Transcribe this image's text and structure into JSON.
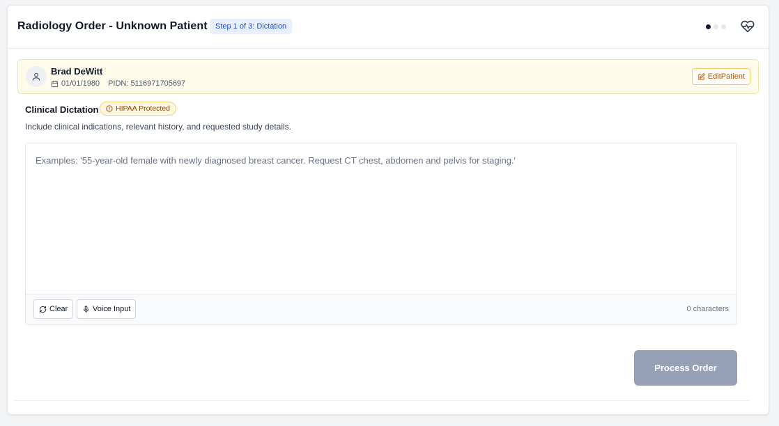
{
  "header": {
    "title": "Radiology Order - Unknown Patient",
    "step_badge": "Step 1 of 3: Dictation",
    "step_indicator": {
      "total": 3,
      "current": 1
    },
    "heart_icon": "heart-pulse-icon"
  },
  "patient": {
    "name": "Brad DeWitt",
    "dob": "01/01/1980",
    "pidn": "PIDN: 5116971705697",
    "edit_label": "EditPatient"
  },
  "dictation": {
    "label": "Clinical Dictation",
    "hipaa_badge": "HIPAA Protected",
    "description": "Include clinical indications, relevant history, and requested study details.",
    "value": "",
    "placeholder": "Examples: '55-year-old female with newly diagnosed breast cancer. Request CT chest, abdomen and pelvis for staging.'",
    "clear_label": "Clear",
    "voice_label": "Voice Input",
    "char_count": "0 characters"
  },
  "actions": {
    "process_label": "Process Order"
  },
  "colors": {
    "accent_blue": "#1d4ed8",
    "badge_blue_bg": "#e8efff",
    "patient_bar_bg": "#fefbea",
    "edit_orange": "#b45309",
    "process_disabled": "#96a1b8"
  }
}
